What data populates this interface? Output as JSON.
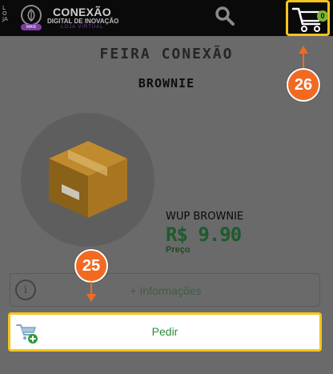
{
  "header": {
    "loja_vertical": "LOJA",
    "loja_vertical_sub": "VIRTUAL",
    "brand_badge": "MAIS",
    "brand_title": "CONEXÃO",
    "brand_subtitle": "DIGITAL DE INOVAÇÃO",
    "brand_tagline": "LOJA VIRTUAL",
    "search_icon": "search-icon",
    "cart_icon": "cart-icon",
    "cart_count": "0"
  },
  "store": {
    "name": "FEIRA CONEXÃO"
  },
  "product": {
    "title": "BROWNIE",
    "name": "WUP BROWNIE",
    "price": "R$ 9.90",
    "price_label": "Preço",
    "image_icon": "box-icon"
  },
  "actions": {
    "info_label": "+ Informações",
    "info_icon": "info-icon",
    "order_label": "Pedir",
    "order_icon": "add-to-cart-icon"
  },
  "callouts": {
    "step_25": "25",
    "step_26": "26"
  },
  "colors": {
    "highlight": "#f5c51a",
    "callout": "#f26a22",
    "price": "#1d5a2d",
    "cart_badge": "#7db536"
  }
}
